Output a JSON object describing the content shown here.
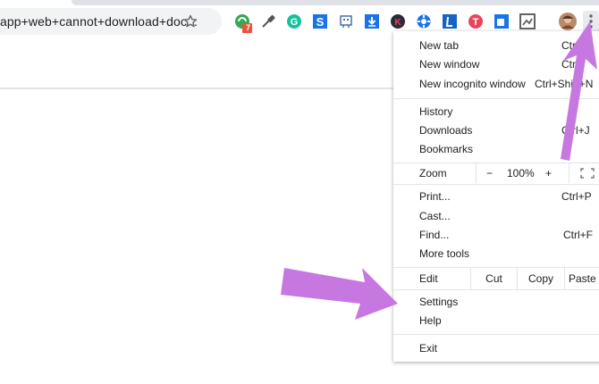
{
  "toolbar": {
    "omnibox_text": "app+web+cannot+download+doc...",
    "star_icon": "star-outline-icon",
    "extensions": [
      {
        "name": "green-circle-extension-icon",
        "color": "#34a853",
        "badge": "7",
        "badge_color": "#e8553e"
      },
      {
        "name": "eyedropper-extension-icon",
        "color": "#555555"
      },
      {
        "name": "grammarly-extension-icon",
        "color": "#15c39a"
      },
      {
        "name": "s-square-extension-icon",
        "color": "#1a73e8"
      },
      {
        "name": "robot-extension-icon",
        "color": "#4a6fa5"
      },
      {
        "name": "download-arrow-extension-icon",
        "color": "#1a73e8"
      },
      {
        "name": "k-circle-extension-icon",
        "color": "#2b2b3a"
      },
      {
        "name": "blue-gear-extension-icon",
        "color": "#1a73e8"
      },
      {
        "name": "l-square-extension-icon",
        "color": "#1565c0"
      },
      {
        "name": "red-t-circle-extension-icon",
        "color": "#e8455b"
      },
      {
        "name": "blue-square-extension-icon",
        "color": "#1a73e8"
      },
      {
        "name": "gray-image-extension-icon",
        "color": "#5f6368"
      }
    ],
    "avatar": "profile-avatar",
    "menu_icon": "three-dot-menu-icon"
  },
  "menu": {
    "new_tab": {
      "label": "New tab",
      "shortcut": "Ctrl"
    },
    "new_window": {
      "label": "New window",
      "shortcut": "Ctrl"
    },
    "new_incognito": {
      "label": "New incognito window",
      "shortcut": "Ctrl+Shift+N"
    },
    "history": {
      "label": "History"
    },
    "downloads": {
      "label": "Downloads",
      "shortcut": "Ctrl+J"
    },
    "bookmarks": {
      "label": "Bookmarks"
    },
    "zoom": {
      "label": "Zoom",
      "minus": "−",
      "value": "100%",
      "plus": "+"
    },
    "print": {
      "label": "Print...",
      "shortcut": "Ctrl+P"
    },
    "cast": {
      "label": "Cast..."
    },
    "find": {
      "label": "Find...",
      "shortcut": "Ctrl+F"
    },
    "more_tools": {
      "label": "More tools"
    },
    "edit": {
      "label": "Edit",
      "cut": "Cut",
      "copy": "Copy",
      "paste": "Paste"
    },
    "settings": {
      "label": "Settings"
    },
    "help": {
      "label": "Help"
    },
    "exit": {
      "label": "Exit"
    }
  },
  "annotation_color": "#c678e0"
}
